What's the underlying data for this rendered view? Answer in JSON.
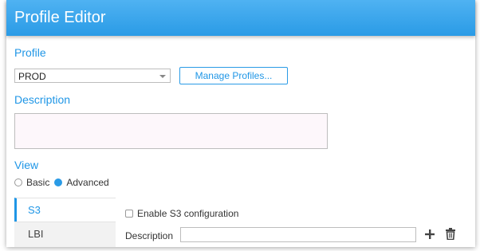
{
  "window": {
    "title": "Profile Editor"
  },
  "profile": {
    "label": "Profile",
    "selected": "PROD",
    "manage_button": "Manage Profiles..."
  },
  "description": {
    "label": "Description",
    "value": ""
  },
  "view": {
    "label": "View",
    "options": [
      {
        "label": "Basic",
        "selected": false
      },
      {
        "label": "Advanced",
        "selected": true
      }
    ]
  },
  "tabs": [
    {
      "label": "S3",
      "active": true
    },
    {
      "label": "LBI",
      "active": false
    }
  ],
  "s3_panel": {
    "enable_label": "Enable S3 configuration",
    "enable_checked": false,
    "description_label": "Description",
    "description_value": ""
  },
  "icons": {
    "add": "plus-icon",
    "delete": "trash-icon"
  },
  "colors": {
    "accent": "#1f96e6",
    "titlebar": "#2a9be6"
  }
}
